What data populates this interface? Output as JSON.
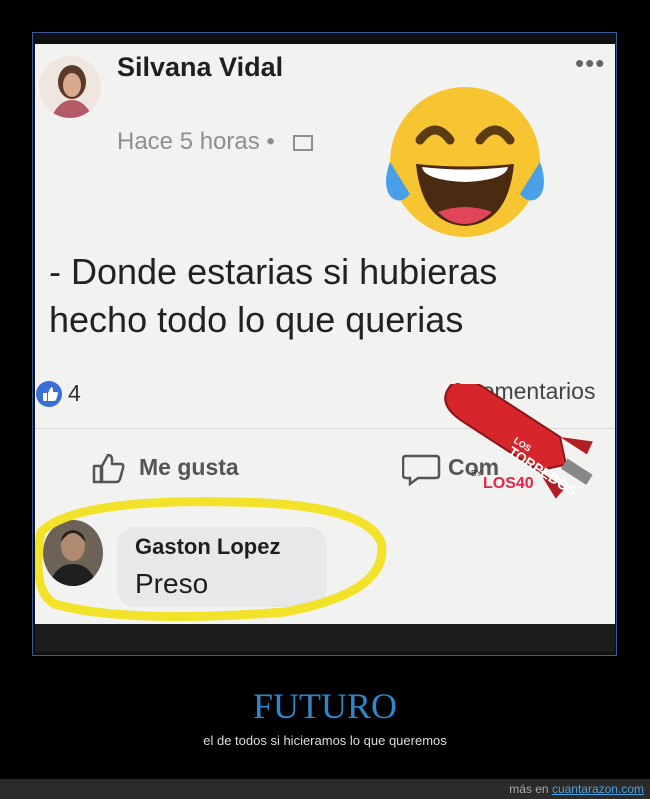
{
  "post": {
    "author": "Silvana Vidal",
    "time": "Hace 5 horas •",
    "more": "•••",
    "text_line1": "- Donde estarias si hubieras",
    "text_line2": "hecho todo lo que querias",
    "like_count": "4",
    "comments": "6 comentarios",
    "like_action": "Me gusta",
    "comment_action": "Com"
  },
  "comment": {
    "author": "Gaston Lopez",
    "text": "Preso"
  },
  "sticker": {
    "brand_line1": "LOS",
    "brand_line2": "TORPEDOS",
    "by": "BY",
    "logo": "LOS40"
  },
  "caption": {
    "title": "FUTURO",
    "subtitle": "el de todos si hicieramos lo que queremos"
  },
  "footer": {
    "prefix": "más en",
    "link": "cuantarazon.com"
  },
  "colors": {
    "caption_blue": "#2f86c8",
    "facebook_blue": "#3b6fd8",
    "highlight_yellow": "#f2e22a",
    "torpedo_red": "#d7262b"
  }
}
